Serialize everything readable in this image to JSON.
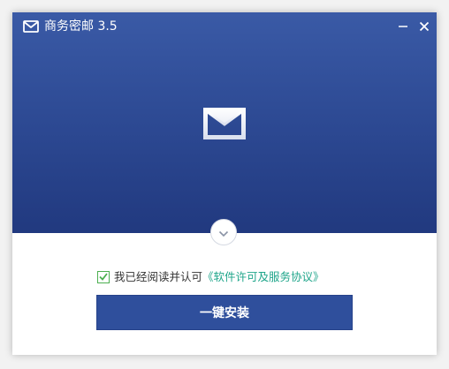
{
  "window": {
    "title": "商务密邮 3.5"
  },
  "agreement": {
    "checked": true,
    "prefix": "我已经阅读并认可",
    "link_text": "《软件许可及服务协议》"
  },
  "install": {
    "label": "一键安装"
  },
  "colors": {
    "hero_top": "#3a5aa6",
    "hero_bottom": "#21397f",
    "button": "#2f4f9c",
    "link": "#1ea58a",
    "checkbox": "#4caf50"
  },
  "icons": {
    "app": "envelope-icon",
    "minimize": "minimize-icon",
    "close": "close-icon",
    "expand": "chevron-down-icon",
    "check": "checkmark-icon"
  }
}
